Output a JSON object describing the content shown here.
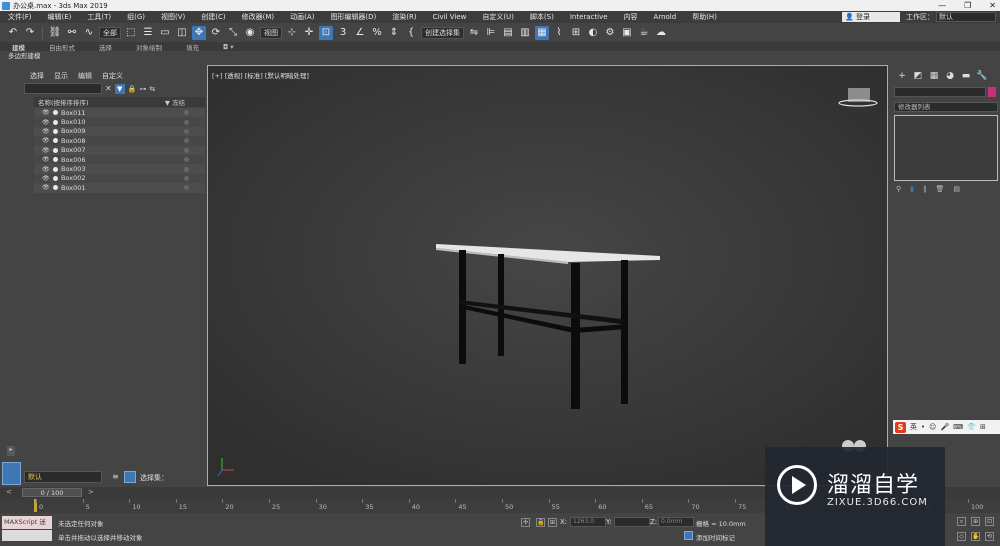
{
  "window": {
    "title": "办公桌.max - 3ds Max 2019",
    "controls": [
      "—",
      "❐",
      "✕"
    ]
  },
  "menubar": {
    "items": [
      "文件(F)",
      "编辑(E)",
      "工具(T)",
      "组(G)",
      "视图(V)",
      "创建(C)",
      "修改器(M)",
      "动画(A)",
      "图形编辑器(D)",
      "渲染(R)",
      "Civil View",
      "自定义(U)",
      "脚本(S)",
      "Interactive",
      "内容",
      "Arnold",
      "帮助(H)"
    ],
    "login": "登录",
    "workspace_label": "工作区：",
    "workspace_value": "默认"
  },
  "toolbar": {
    "filter_value": "全部",
    "refcoord_value": "视图",
    "selset_value": "创建选择集"
  },
  "ribbon": {
    "tabs": [
      "建模",
      "自由形式",
      "选择",
      "对象绘制",
      "填充"
    ],
    "subpanel": "多边形建模"
  },
  "scene_explorer": {
    "menu": [
      "选择",
      "显示",
      "编辑",
      "自定义"
    ],
    "col_name": "名称(按排序排序)",
    "col_freeze": "▼ 冻结",
    "objects": [
      "Box011",
      "Box010",
      "Box009",
      "Box008",
      "Box007",
      "Box006",
      "Box003",
      "Box002",
      "Box001"
    ]
  },
  "viewport": {
    "label": "[+] [透视] [标准] [默认明暗处理]"
  },
  "command_panel": {
    "modifier_list": "修改器列表"
  },
  "ime": {
    "logo": "S",
    "lang": "英"
  },
  "layer": {
    "current": "默认",
    "selection_set": "选择集："
  },
  "time": {
    "frame": "0 / 100",
    "ticks": [
      "0",
      "5",
      "10",
      "15",
      "20",
      "25",
      "30",
      "35",
      "40",
      "45",
      "50",
      "55",
      "60",
      "65",
      "70",
      "75",
      "80",
      "85",
      "90",
      "95",
      "100"
    ]
  },
  "status": {
    "maxscript": "MAXScript 迷",
    "message": "未选定任何对象",
    "hint": "单击并拖动以选择并移动对象",
    "x_label": "X:",
    "x_value": "1263.0",
    "y_label": "Y:",
    "y_value": "",
    "z_label": "Z:",
    "z_value": "0.0mm",
    "grid": "栅格 = 10.0mm",
    "add_time": "添加时间标记"
  },
  "watermark": {
    "title": "溜溜自学",
    "subtitle": "ZIXUE.3D66.COM"
  },
  "colors": {
    "accent": "#3d78b5",
    "viewport_border": "#d6b420",
    "object_color": "#c8307a",
    "table_top": "#e6e6e6",
    "table_legs": "#0c0c0c"
  }
}
